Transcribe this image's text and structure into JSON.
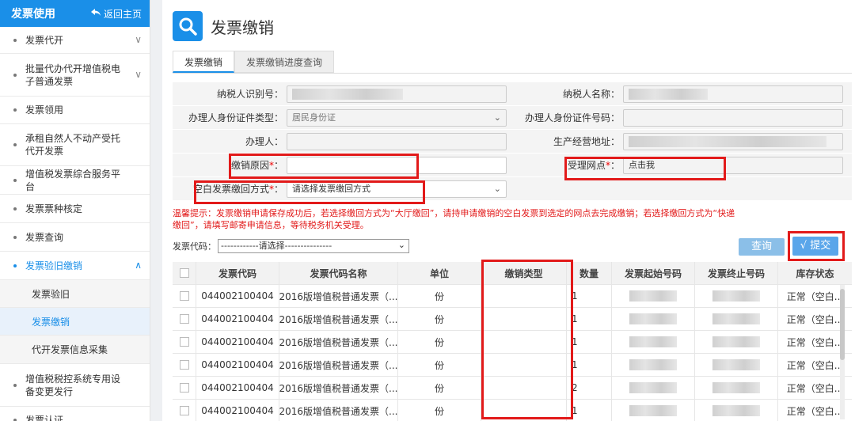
{
  "sidebar": {
    "title": "发票使用",
    "back_label": "返回主页",
    "items": [
      {
        "label": "发票代开",
        "chevron": "∨"
      },
      {
        "label": "批量代办代开增值税电子普通发票",
        "chevron": "∨"
      },
      {
        "label": "发票领用"
      },
      {
        "label": "承租自然人不动产受托代开发票"
      },
      {
        "label": "增值税发票综合服务平台"
      },
      {
        "label": "发票票种核定"
      },
      {
        "label": "发票查询"
      },
      {
        "label": "发票验旧缴销",
        "chevron": "∧"
      }
    ],
    "subitems": [
      "发票验旧",
      "发票缴销",
      "代开发票信息采集"
    ],
    "items_after": [
      {
        "label": "增值税税控系统专用设备变更发行"
      },
      {
        "label": "发票认证"
      }
    ]
  },
  "main": {
    "title": "发票缴销",
    "tabs": [
      "发票缴销",
      "发票缴销进度查询"
    ],
    "form": {
      "taxpayer_id_label": "纳税人识别号：",
      "taxpayer_name_label": "纳税人名称：",
      "id_type_label": "办理人身份证件类型：",
      "id_type_value": "居民身份证",
      "id_number_label": "办理人身份证件号码：",
      "handler_label": "办理人：",
      "address_label": "生产经营地址：",
      "cancel_reason_label": "缴销原因",
      "office_label": "受理网点",
      "office_value": "点击我",
      "return_method_label": "空白发票缴回方式",
      "return_method_placeholder": "请选择发票缴回方式",
      "required_mark": "*",
      "colon": "："
    },
    "warning": "温馨提示：发票缴销申请保存成功后，若选择缴回方式为“大厅缴回”，请持申请缴销的空白发票到选定的网点去完成缴销；若选择缴回方式为“快递缴回”，请填写邮寄申请信息，等待税务机关受理。",
    "code_label": "发票代码：",
    "code_select": "------------请选择---------------",
    "query_button": "查询",
    "submit_button": "√ 提交",
    "table": {
      "headers": [
        "发票代码",
        "发票代码名称",
        "单位",
        "缴销类型",
        "数量",
        "发票起始号码",
        "发票终止号码",
        "库存状态"
      ],
      "rows": [
        {
          "code": "044002100404",
          "name": "2016版增值税普通发票（...",
          "unit": "份",
          "qty": "1",
          "status": "正常（空白..."
        },
        {
          "code": "044002100404",
          "name": "2016版增值税普通发票（...",
          "unit": "份",
          "qty": "1",
          "status": "正常（空白..."
        },
        {
          "code": "044002100404",
          "name": "2016版增值税普通发票（...",
          "unit": "份",
          "qty": "1",
          "status": "正常（空白..."
        },
        {
          "code": "044002100404",
          "name": "2016版增值税普通发票（...",
          "unit": "份",
          "qty": "1",
          "status": "正常（空白..."
        },
        {
          "code": "044002100404",
          "name": "2016版增值税普通发票（...",
          "unit": "份",
          "qty": "2",
          "status": "正常（空白..."
        },
        {
          "code": "044002100404",
          "name": "2016版增值税普通发票（...",
          "unit": "份",
          "qty": "1",
          "status": "正常（空白..."
        }
      ]
    }
  },
  "colors": {
    "accent": "#1a8fe8",
    "highlight": "#e21a1a"
  }
}
